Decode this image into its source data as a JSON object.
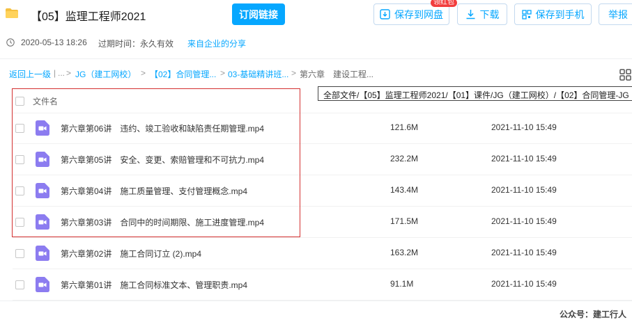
{
  "header": {
    "title": "【05】监理工程师2021",
    "subscribe_label": "订阅链接",
    "save_to_disk_label": "保存到网盘",
    "red_packet_badge": "领红包",
    "download_label": "下载",
    "save_to_phone_label": "保存到手机",
    "report_label": "举报"
  },
  "meta": {
    "created": "2020-05-13 18:26",
    "expire_label": "过期时间：永久有效",
    "source": "来自企业的分享"
  },
  "breadcrumb": {
    "back": "返回上一级",
    "sep1": "|",
    "ellipsis": "...",
    "c1": "JG（建工网校）",
    "c2": "【02】合同管理...",
    "c3": "03-基础精讲班...",
    "current": "第六章　建设工程..."
  },
  "tooltip": "全部文件/【05】监理工程师2021/【01】课件/JG（建工网校）/【02】合同管理-JG",
  "table": {
    "col_name": "文件名",
    "rows": [
      {
        "name": "第六章第06讲　违约、竣工验收和缺陷责任期管理.mp4",
        "size": "121.6M",
        "date": "2021-11-10 15:49"
      },
      {
        "name": "第六章第05讲　安全、变更、索赔管理和不可抗力.mp4",
        "size": "232.2M",
        "date": "2021-11-10 15:49"
      },
      {
        "name": "第六章第04讲　施工质量管理、支付管理概念.mp4",
        "size": "143.4M",
        "date": "2021-11-10 15:49"
      },
      {
        "name": "第六章第03讲　合同中的时间期限、施工进度管理.mp4",
        "size": "171.5M",
        "date": "2021-11-10 15:49"
      },
      {
        "name": "第六章第02讲　施工合同订立 (2).mp4",
        "size": "163.2M",
        "date": "2021-11-10 15:49"
      },
      {
        "name": "第六章第01讲　施工合同标准文本、管理职责.mp4",
        "size": "91.1M",
        "date": "2021-11-10 15:49"
      }
    ]
  },
  "footer": "公众号：建工行人",
  "colors": {
    "accent": "#06a7ff",
    "video_icon": "#8c7cf0",
    "highlight_box": "#d32f2f"
  }
}
